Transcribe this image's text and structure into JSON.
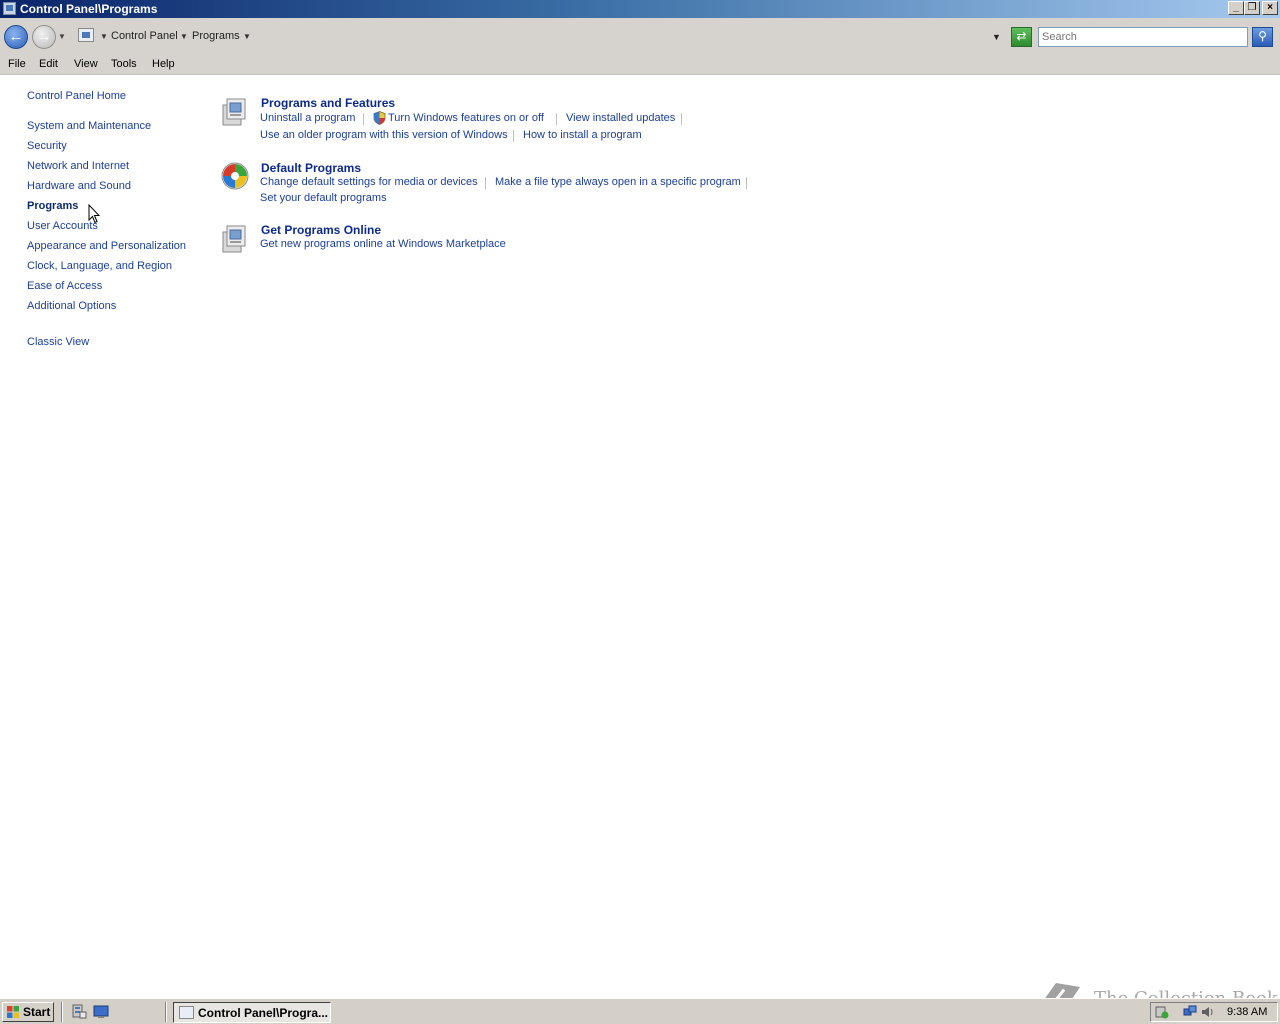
{
  "window": {
    "title": "Control Panel\\Programs"
  },
  "address": {
    "crumbs": [
      "Control Panel",
      "Programs"
    ],
    "search_placeholder": "Search"
  },
  "menubar": {
    "items": [
      "File",
      "Edit",
      "View",
      "Tools",
      "Help"
    ]
  },
  "sidebar": {
    "home": "Control Panel Home",
    "items": [
      "System and Maintenance",
      "Security",
      "Network and Internet",
      "Hardware and Sound",
      "Programs",
      "User Accounts",
      "Appearance and Personalization",
      "Clock, Language, and Region",
      "Ease of Access",
      "Additional Options"
    ],
    "active": "Programs",
    "classic_view": "Classic View"
  },
  "categories": [
    {
      "title": "Programs and Features",
      "links": [
        "Uninstall a program",
        "Turn Windows features on or off",
        "View installed updates",
        "Use an older program with this version of Windows",
        "How to install a program"
      ]
    },
    {
      "title": "Default Programs",
      "links": [
        "Change default settings for media or devices",
        "Make a file type always open in a specific program",
        "Set your default programs"
      ]
    },
    {
      "title": "Get Programs Online",
      "links": [
        "Get new programs online at Windows Marketplace"
      ]
    }
  ],
  "taskbar": {
    "start_label": "Start",
    "task_item": "Control Panel\\Progra...",
    "clock": "9:38 AM"
  },
  "watermark": "The Collection Book",
  "icons": {
    "back": "back-arrow-icon",
    "forward": "forward-arrow-icon",
    "refresh": "refresh-icon",
    "search": "search-icon",
    "shield": "uac-shield-icon"
  }
}
